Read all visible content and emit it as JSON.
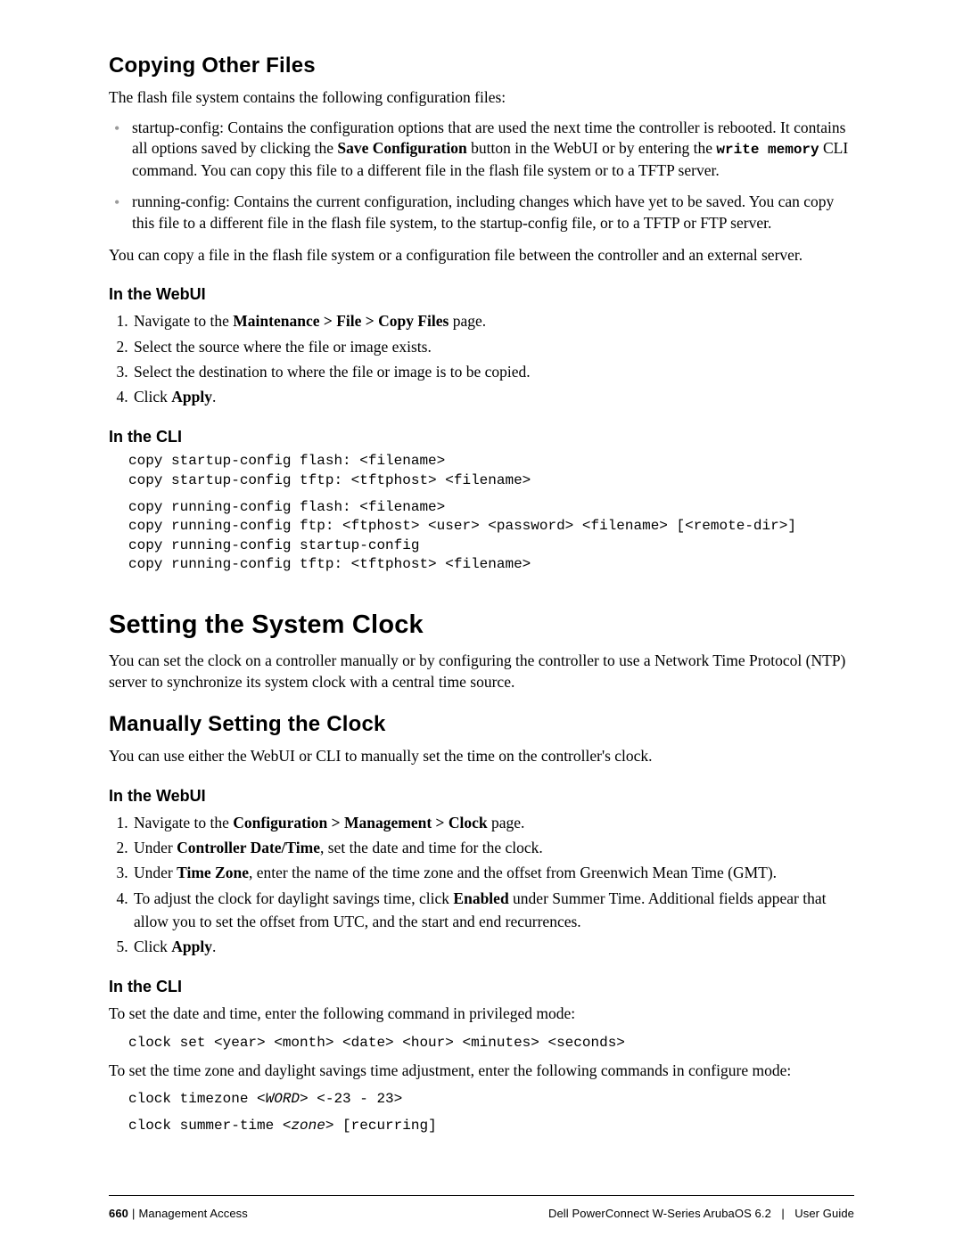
{
  "copying": {
    "title": "Copying Other Files",
    "intro": "The flash file system contains the following configuration files:",
    "b1_a": "startup-config: Contains the configuration options that are used the next time the controller is rebooted. It contains all options saved by clicking the ",
    "b1_b": "Save Configuration",
    "b1_c": " button in the WebUI or by entering the ",
    "b1_d": "write memory",
    "b1_e": " CLI command. You can copy this file to a different file in the flash file system or to a TFTP server.",
    "b2": "running-config: Contains the current configuration, including changes which have yet to be saved. You can copy this file to a different file in the flash file system, to the startup-config file, or to a TFTP or FTP server.",
    "para2": "You can copy a file in the flash file system or a configuration file between the controller and an external server.",
    "webui_h": "In the WebUI",
    "w1a": "Navigate to the ",
    "w1b": "Maintenance > File > Copy Files",
    "w1c": " page.",
    "w2": "Select the source where the file or image exists.",
    "w3": "Select the destination to where the file or image is to be copied.",
    "w4a": "Click ",
    "w4b": "Apply",
    "w4c": ".",
    "cli_h": "In the CLI",
    "code1": "copy startup-config flash: <filename>\ncopy startup-config tftp: <tftphost> <filename>",
    "code2": "copy running-config flash: <filename>\ncopy running-config ftp: <ftphost> <user> <password> <filename> [<remote-dir>]\ncopy running-config startup-config\ncopy running-config tftp: <tftphost> <filename>"
  },
  "clock": {
    "title": "Setting the System Clock",
    "intro": "You can set the clock on a controller manually or by configuring the controller to use a Network Time Protocol (NTP) server to synchronize its system clock with a central time source.",
    "manual_h": "Manually Setting the Clock",
    "manual_intro": "You can use either the WebUI or CLI to manually set the time on the controller's clock.",
    "webui_h": "In the WebUI",
    "w1a": "Navigate to the ",
    "w1b": "Configuration > Management > Clock",
    "w1c": " page.",
    "w2a": "Under ",
    "w2b": "Controller Date/Time",
    "w2c": ", set the date and time for the clock.",
    "w3a": "Under ",
    "w3b": "Time Zone",
    "w3c": ", enter the name of the time zone and the offset from Greenwich Mean Time (GMT).",
    "w4a": "To adjust the clock for daylight savings time, click ",
    "w4b": "Enabled",
    "w4c": " under Summer Time. Additional fields appear that allow you to set the offset from UTC, and the start and end recurrences.",
    "w5a": "Click ",
    "w5b": "Apply",
    "w5c": ".",
    "cli_h": "In the CLI",
    "cli_p1": "To set the date and time, enter the following command in privileged mode:",
    "code1": "clock set <year> <month> <date> <hour> <minutes> <seconds>",
    "cli_p2": "To set the time zone and daylight savings time adjustment, enter the following commands in configure mode:",
    "code2a": "clock timezone <",
    "code2b": "WORD",
    "code2c": "> <-23 - 23>",
    "code3a": "clock summer-time <",
    "code3b": "zone",
    "code3c": "> [recurring]"
  },
  "footer": {
    "page_no": "660",
    "left_text": "Management Access",
    "right_text_a": "Dell PowerConnect W-Series ArubaOS 6.2",
    "right_text_b": "User Guide"
  }
}
